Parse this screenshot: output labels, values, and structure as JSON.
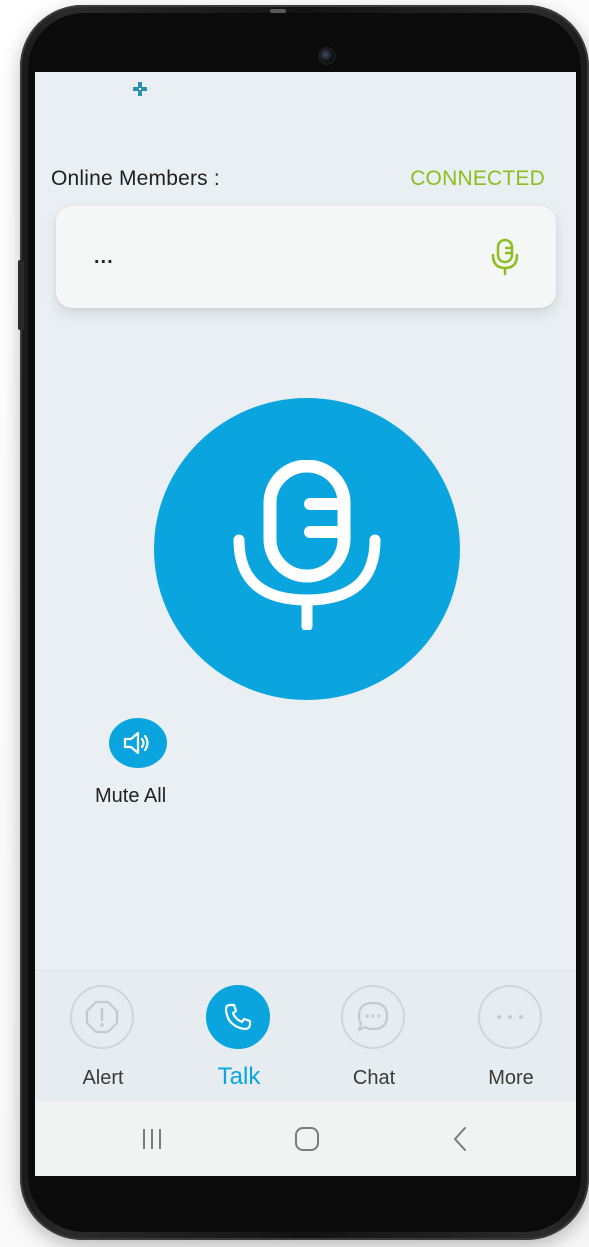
{
  "header": {
    "online_members_label": "Online Members :",
    "connection_status": "CONNECTED"
  },
  "members": [
    {
      "name": "..."
    }
  ],
  "controls": {
    "mute_all_label": "Mute All"
  },
  "bottom_nav": {
    "items": [
      {
        "label": "Alert",
        "icon": "alert-icon",
        "active": false
      },
      {
        "label": "Talk",
        "icon": "phone-icon",
        "active": true
      },
      {
        "label": "Chat",
        "icon": "chat-icon",
        "active": false
      },
      {
        "label": "More",
        "icon": "more-dots-icon",
        "active": false
      }
    ]
  },
  "system_nav": {
    "items": [
      "recent-apps-icon",
      "home-icon",
      "back-icon"
    ]
  },
  "colors": {
    "accent": "#0aa5df",
    "connected": "#8cbf1e",
    "mic_small": "#8cbf1e",
    "background": "#e9eff3"
  }
}
